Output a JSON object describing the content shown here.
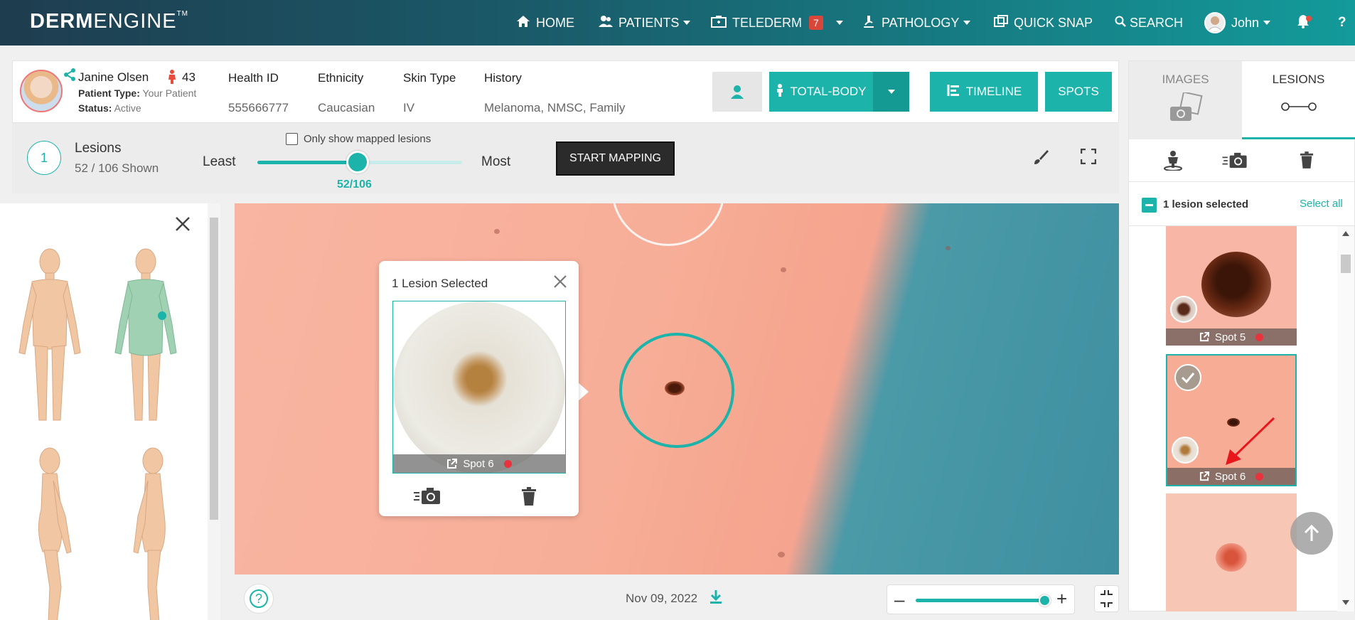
{
  "nav": {
    "logo_bold": "DERM",
    "logo_light": "ENGINE",
    "logo_tm": "TM",
    "home": "HOME",
    "patients": "PATIENTS",
    "telederm": "TELEDERM",
    "telederm_badge": "7",
    "pathology": "PATHOLOGY",
    "quick_snap": "QUICK SNAP",
    "search": "SEARCH",
    "user": "John"
  },
  "patient": {
    "name": "Janine Olsen",
    "age": "43",
    "type_label": "Patient Type:",
    "type_value": "Your Patient",
    "status_label": "Status:",
    "status_value": "Active",
    "fields": [
      {
        "header": "Health ID",
        "value": "555666777"
      },
      {
        "header": "Ethnicity",
        "value": "Caucasian"
      },
      {
        "header": "Skin Type",
        "value": "IV"
      },
      {
        "header": "History",
        "value": "Melanoma, NMSC, Family"
      }
    ],
    "btn_total_body": "TOTAL-BODY",
    "btn_timeline": "TIMELINE",
    "btn_spots": "SPOTS"
  },
  "lesion_bar": {
    "count": "1",
    "title": "Lesions",
    "shown": "52 / 106 Shown",
    "least": "Least",
    "most": "Most",
    "mapped_only": "Only show mapped lesions",
    "slider_value": "52/106",
    "slider_fraction": 0.49,
    "start_mapping": "START MAPPING"
  },
  "popup": {
    "title": "1 Lesion Selected",
    "spot_label": "Spot 6"
  },
  "bottom": {
    "date": "Nov 09, 2022",
    "zoom_fraction": 0.95
  },
  "right": {
    "tab_images": "IMAGES",
    "tab_lesions": "LESIONS",
    "selected_text": "1 lesion selected",
    "select_all": "Select all",
    "thumbs": [
      {
        "label": "Spot 5"
      },
      {
        "label": "Spot 6"
      }
    ]
  },
  "colors": {
    "accent": "#1bb3aa",
    "dark_button": "#2b2b2b",
    "status_red": "#e8323c"
  }
}
